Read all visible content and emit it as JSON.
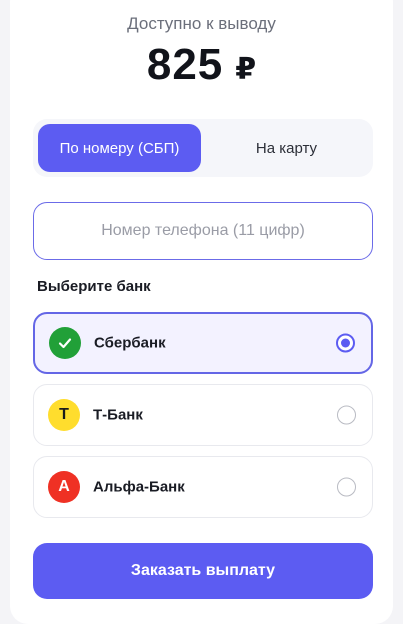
{
  "balance": {
    "label": "Доступно к выводу",
    "amount": "825",
    "currency": "₽"
  },
  "tabs": [
    {
      "label": "По номеру (СБП)",
      "active": true
    },
    {
      "label": "На карту",
      "active": false
    }
  ],
  "phone_input": {
    "value": "",
    "placeholder": "Номер телефона (11 цифр)"
  },
  "bank_section": {
    "title": "Выберите банк"
  },
  "banks": [
    {
      "name": "Сбербанк",
      "icon": "check-icon",
      "icon_color": "#21a038",
      "selected": true
    },
    {
      "name": "Т-Банк",
      "icon": "Т",
      "icon_color": "#ffdd2d",
      "selected": false
    },
    {
      "name": "Альфа-Банк",
      "icon": "А",
      "icon_color": "#ef3124",
      "selected": false
    }
  ],
  "submit": {
    "label": "Заказать выплату"
  },
  "colors": {
    "accent": "#5c5cf2",
    "selected_bg": "#f3f2ff"
  }
}
